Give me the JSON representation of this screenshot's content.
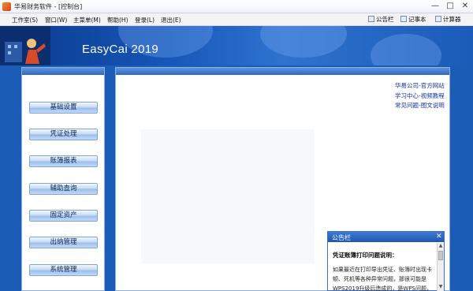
{
  "window": {
    "title": "华易财务软件 - [控制台]",
    "minimize_glyph": "—",
    "maximize_glyph": "□",
    "close_glyph": "✕"
  },
  "menu": {
    "items": [
      "工作室(S)",
      "窗口(W)",
      "主菜单(M)",
      "帮助(H)",
      "登录(L)",
      "退出(E)"
    ]
  },
  "toolbar": {
    "bulletin_label": "公告栏",
    "notepad_label": "记事本",
    "calculator_label": "计算器"
  },
  "banner": {
    "title": "EasyCai 2019"
  },
  "nav": {
    "buttons": [
      "基础设置",
      "凭证处理",
      "账簿报表",
      "辅助查询",
      "固定资产",
      "出纳管理",
      "系统管理"
    ]
  },
  "links": [
    "华易公司-官方网站",
    "学习中心-视频教程",
    "常见问题-图文说明"
  ],
  "bulletin": {
    "title": "公告栏",
    "close_glyph": "✕",
    "subtitle": "凭证账簿打印问题说明：",
    "body": "如果最近在打印导出凭证、账簿时出现卡顿、死机等各种异常问题，那很可能是WPS2019升级后造成的，是WPS问题，",
    "scroll_up": "▲",
    "scroll_down": "▼"
  },
  "colors": {
    "banner_blue": "#1656b8",
    "frame_blue": "#1b5db6",
    "link_blue": "#1030a8"
  }
}
